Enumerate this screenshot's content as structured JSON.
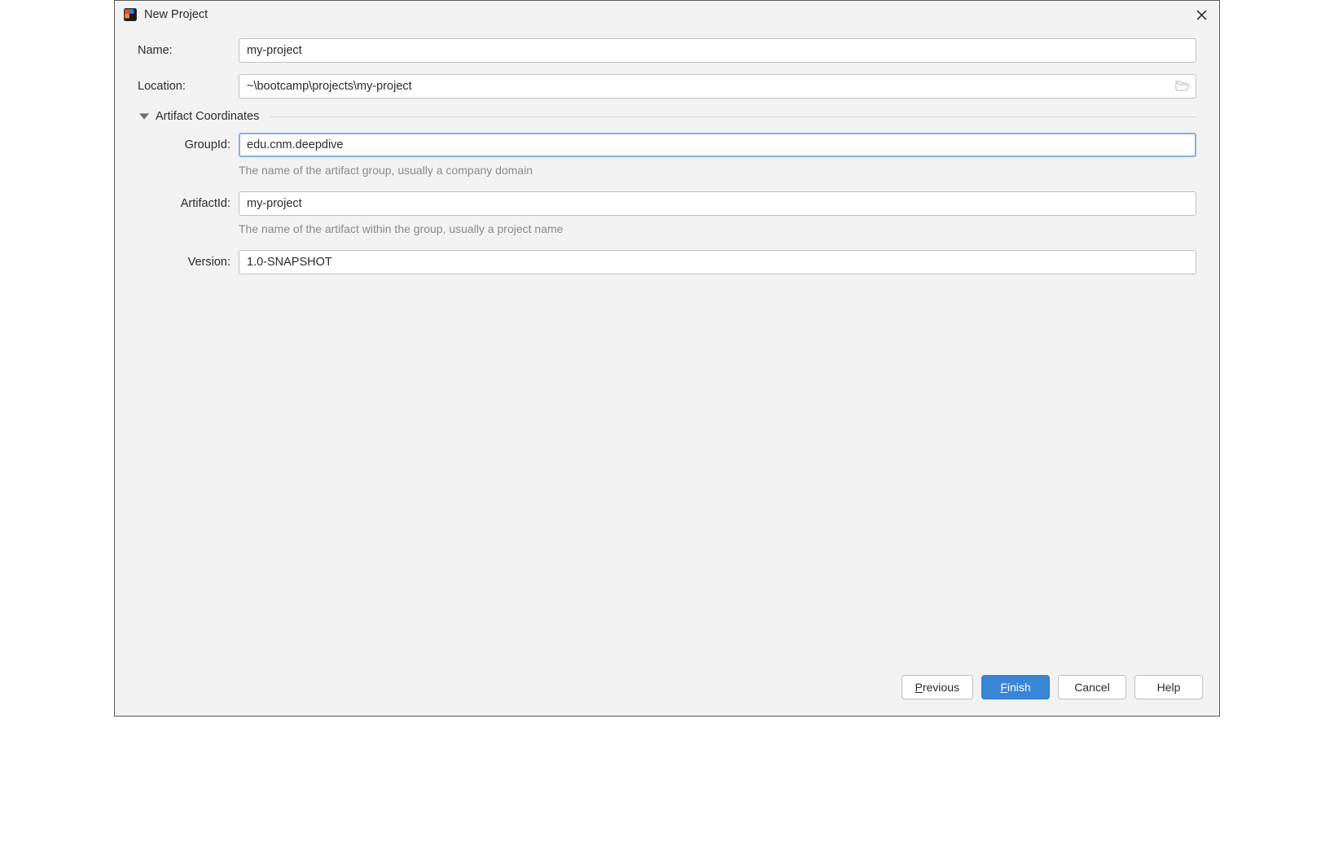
{
  "window": {
    "title": "New Project"
  },
  "form": {
    "name_label": "Name:",
    "name_value": "my-project",
    "location_label": "Location:",
    "location_value": "~\\bootcamp\\projects\\my-project"
  },
  "section": {
    "title": "Artifact Coordinates"
  },
  "artifact": {
    "groupid_label": "GroupId:",
    "groupid_value": "edu.cnm.deepdive",
    "groupid_hint": "The name of the artifact group, usually a company domain",
    "artifactid_label": "ArtifactId:",
    "artifactid_value": "my-project",
    "artifactid_hint": "The name of the artifact within the group, usually a project name",
    "version_label": "Version:",
    "version_value": "1.0-SNAPSHOT"
  },
  "buttons": {
    "previous": "Previous",
    "finish": "Finish",
    "cancel": "Cancel",
    "help": "Help"
  }
}
